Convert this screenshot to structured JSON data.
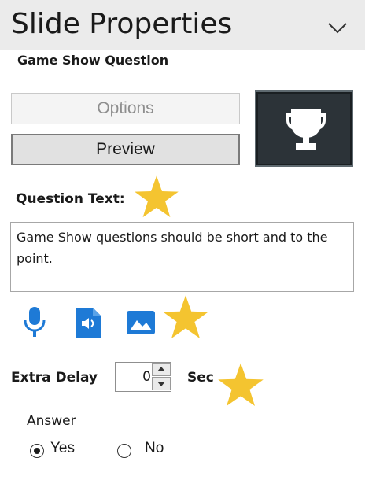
{
  "header": {
    "title": "Slide Properties",
    "collapse_icon": "chevron-down-icon"
  },
  "slide_type": "Game Show Question",
  "buttons": {
    "options_label": "Options",
    "preview_label": "Preview"
  },
  "slide_icon": "trophy-icon",
  "question": {
    "label": "Question Text:",
    "value": "Game Show questions should be short and to the point."
  },
  "media_icons": [
    "microphone-icon",
    "audio-file-icon",
    "image-icon"
  ],
  "delay": {
    "label": "Extra Delay",
    "value": "0",
    "unit": "Sec"
  },
  "answer": {
    "label": "Answer",
    "options": [
      "Yes",
      "No"
    ],
    "selected": "Yes"
  },
  "colors": {
    "accent_blue": "#1e7ad6",
    "star_gold": "#f4c430",
    "tile_dark": "#2c3338"
  }
}
